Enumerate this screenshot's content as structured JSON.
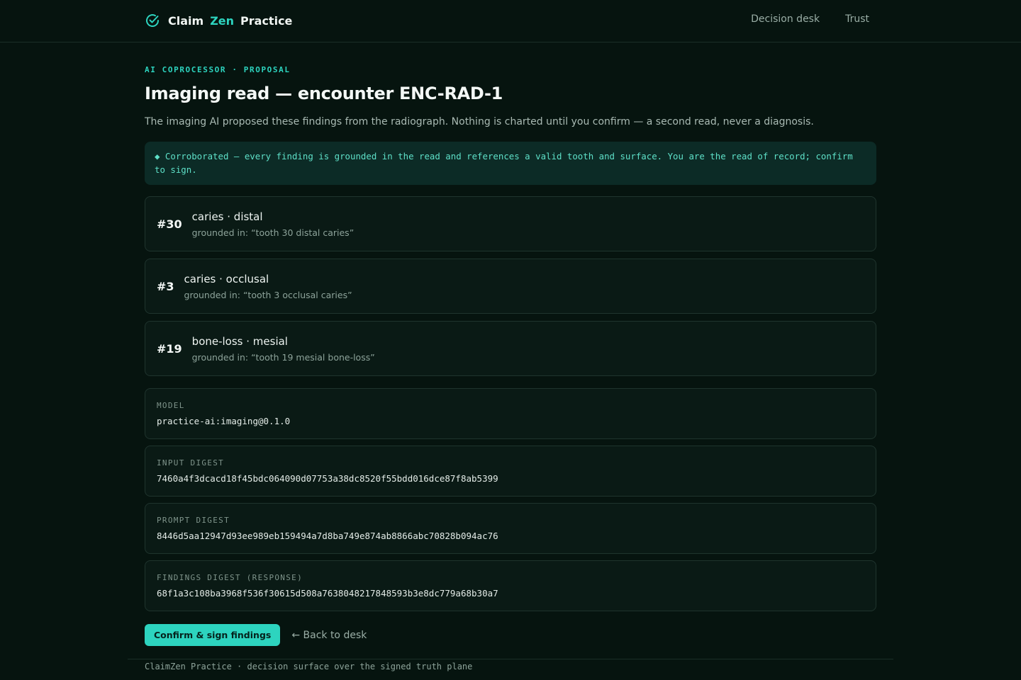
{
  "header": {
    "brand": {
      "part1": "Claim",
      "part2": "Zen",
      "part3": "Practice",
      "icon": "check-circle-icon"
    },
    "nav": [
      {
        "label": "Decision desk"
      },
      {
        "label": "Trust"
      }
    ]
  },
  "page": {
    "eyebrow": "AI COPROCESSOR · PROPOSAL",
    "title": "Imaging read — encounter ENC-RAD-1",
    "lede": "The imaging AI proposed these findings from the radiograph. Nothing is charted until you confirm — a second read, never a diagnosis.",
    "banner": "◆ Corroborated — every finding is grounded in the read and references a valid tooth and surface. You are the read of record; confirm to sign."
  },
  "findings": [
    {
      "tooth": "#30",
      "title": "caries · distal",
      "grounded": "grounded in: “tooth 30 distal caries”"
    },
    {
      "tooth": "#3",
      "title": "caries · occlusal",
      "grounded": "grounded in: “tooth 3 occlusal caries”"
    },
    {
      "tooth": "#19",
      "title": "bone-loss · mesial",
      "grounded": "grounded in: “tooth 19 mesial bone-loss”"
    }
  ],
  "meta": [
    {
      "label": "MODEL",
      "value": "practice-ai:imaging@0.1.0"
    },
    {
      "label": "INPUT DIGEST",
      "value": "7460a4f3dcacd18f45bdc064090d07753a38dc8520f55bdd016dce87f8ab5399"
    },
    {
      "label": "PROMPT DIGEST",
      "value": "8446d5aa12947d93ee989eb159494a7d8ba749e874ab8866abc70828b094ac76"
    },
    {
      "label": "FINDINGS DIGEST (RESPONSE)",
      "value": "68f1a3c108ba3968f536f30615d508a7638048217848593b3e8dc779a68b30a7"
    }
  ],
  "actions": {
    "confirm_label": "Confirm & sign findings",
    "back_label": "← Back to desk"
  },
  "footer": {
    "text": "ClaimZen Practice · decision surface over the signed truth plane"
  },
  "colors": {
    "background": "#06140f",
    "accent": "#2dd4bf",
    "card": "#0a1a15",
    "banner": "#0c2b26"
  }
}
